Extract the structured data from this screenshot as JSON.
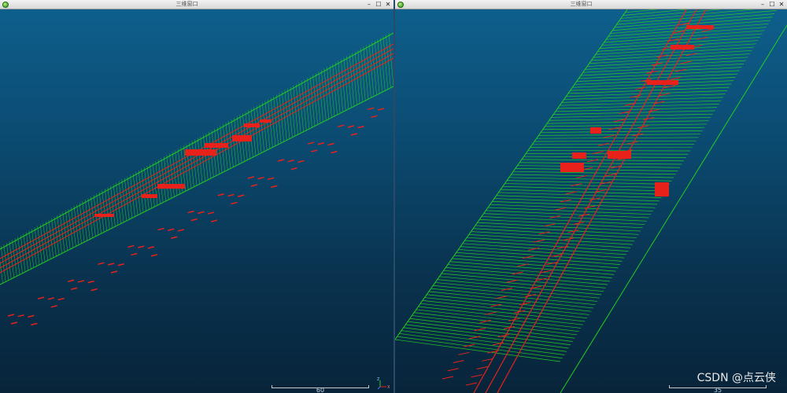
{
  "left_window": {
    "title": "三维窗口",
    "scale_value": "60",
    "axis_labels": {
      "z": "Z",
      "x": "X"
    }
  },
  "right_window": {
    "title": "三维窗口",
    "scale_value": "35"
  },
  "controls": {
    "minimize": "–",
    "maximize": "☐",
    "close": "✕"
  },
  "watermark": "CSDN @点云侠",
  "colors": {
    "mesh": "#22cc22",
    "lines": "#e8221b",
    "sky": "#0e5f8c"
  }
}
